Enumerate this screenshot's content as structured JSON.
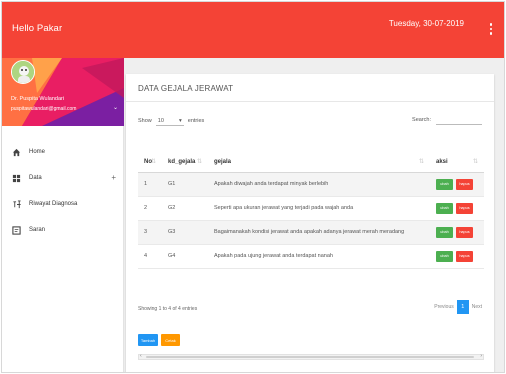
{
  "topbar": {
    "brand": "Hello Pakar",
    "date": "Tuesday, 30-07-2019",
    "menu_icon": "more-vert-icon",
    "color": "#f44336"
  },
  "sidebar": {
    "user": {
      "name": "Dr. Puspita Wulandari",
      "email": "puspitawulandari@gmail.com"
    },
    "items": [
      {
        "label": "Home",
        "icon": "home-icon"
      },
      {
        "label": "Data",
        "icon": "grid-icon",
        "has_plus": true,
        "plus": "+"
      },
      {
        "label": "Riwayat Diagnosa",
        "icon": "history-icon"
      },
      {
        "label": "Saran",
        "icon": "message-icon"
      }
    ]
  },
  "card": {
    "title": "DATA GEJALA JERAWAT",
    "show_label": "Show",
    "entries_value": "10",
    "entries_label": "entries",
    "search_label": "Search:",
    "search_placeholder": ""
  },
  "table": {
    "columns": [
      "No",
      "kd_gejala",
      "gejala",
      "aksi"
    ],
    "rows": [
      {
        "no": "1",
        "kd": "G1",
        "gejala": "Apakah diwajah anda terdapat minyak berlebih"
      },
      {
        "no": "2",
        "kd": "G2",
        "gejala": "Seperti apa ukuran jerawat yang terjadi pada wajah anda"
      },
      {
        "no": "3",
        "kd": "G3",
        "gejala": "Bagaimanakah kondisi jerawat anda apakah adanya jerawat merah meradang"
      },
      {
        "no": "4",
        "kd": "G4",
        "gejala": "Apakah pada ujung jerawat anda terdapat nanah"
      }
    ],
    "edit_label": "ubah",
    "delete_label": "hapus"
  },
  "footer": {
    "info": "Showing 1 to 4 of 4 entries",
    "prev": "Previous",
    "page": "1",
    "next": "Next",
    "add_label": "Tambah",
    "print_label": "Cetak"
  },
  "colors": {
    "primary": "#f44336",
    "edit": "#4caf50",
    "delete": "#f44336",
    "add": "#2196f3",
    "print": "#ff9800",
    "active_page": "#2196f3"
  }
}
